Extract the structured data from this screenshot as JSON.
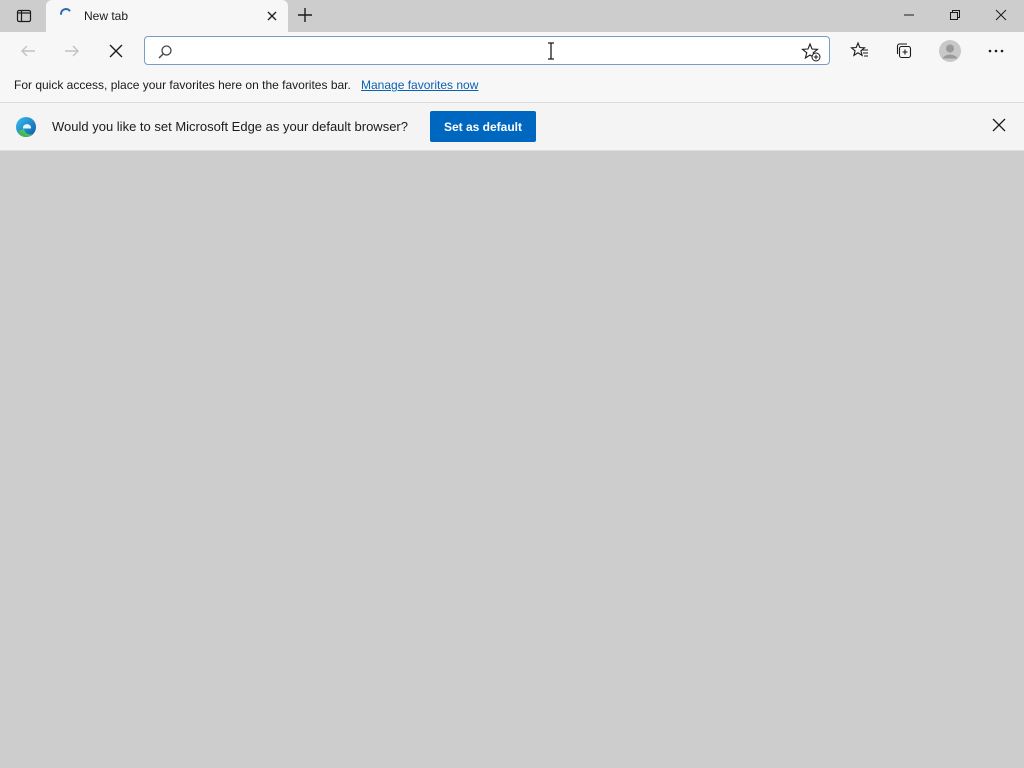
{
  "tab": {
    "title": "New tab"
  },
  "addressbar": {
    "value": "",
    "placeholder": ""
  },
  "favorites_bar": {
    "message": "For quick access, place your favorites here on the favorites bar.",
    "link_label": "Manage favorites now"
  },
  "infobar": {
    "message": "Would you like to set Microsoft Edge as your default browser?",
    "button_label": "Set as default"
  },
  "colors": {
    "accent": "#0067c0",
    "link": "#0b62b3",
    "chrome_background": "#cdcdcd",
    "toolbar_background": "#f7f7f7"
  },
  "icons": {
    "tab_actions": "tab-actions-icon",
    "loading": "loading-spinner-icon",
    "tab_close": "close-icon",
    "new_tab": "plus-icon",
    "back": "back-arrow-icon",
    "forward": "forward-arrow-icon",
    "stop": "stop-icon",
    "search": "search-icon",
    "add_favorite": "star-add-icon",
    "favorites": "favorites-icon",
    "collections": "collections-icon",
    "profile": "profile-icon",
    "more": "more-icon",
    "edge": "edge-logo-icon"
  }
}
